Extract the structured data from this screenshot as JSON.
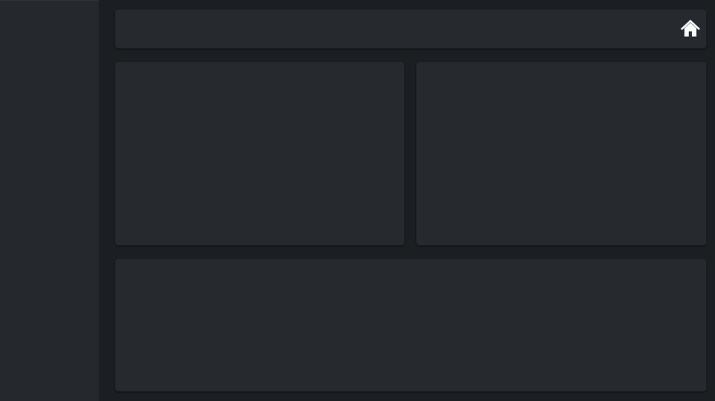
{
  "colors": {
    "background": "#1c1f22",
    "sidebar": "#25292d",
    "card": "#262a2e",
    "icon": "#ffffff"
  },
  "topbar": {
    "home_icon": "home-icon"
  }
}
